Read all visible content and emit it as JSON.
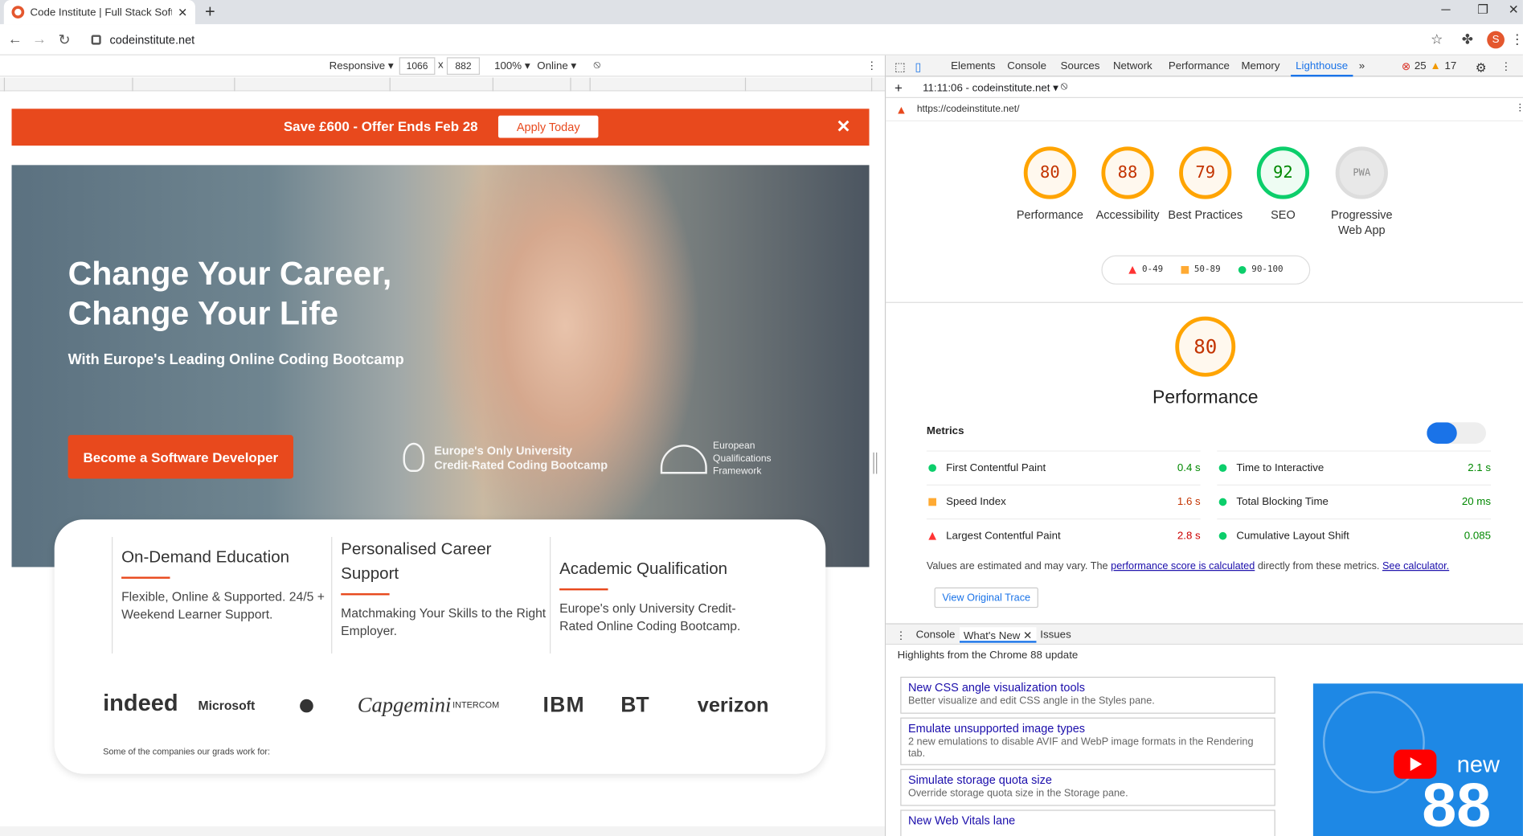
{
  "browser": {
    "tab_title": "Code Institute | Full Stack Softwa",
    "url": "codeinstitute.net",
    "avatar_letter": "S"
  },
  "device_toolbar": {
    "mode": "Responsive",
    "width": "1066",
    "height": "882",
    "zoom": "100%",
    "network": "Online"
  },
  "page": {
    "banner_text": "Save £600 - Offer Ends Feb 28",
    "banner_button": "Apply Today",
    "hero_title_1": "Change Your Career,",
    "hero_title_2": "Change Your Life",
    "hero_subtitle": "With Europe's Leading Online Coding Bootcamp",
    "hero_cta": "Become a Software Developer",
    "badge1_line1": "Europe's Only University",
    "badge1_line2": "Credit-Rated Coding Bootcamp",
    "badge2_line1": "European",
    "badge2_line2": "Qualifications",
    "badge2_line3": "Framework",
    "columns": [
      {
        "title": "On-Demand Education",
        "text": "Flexible, Online & Supported. 24/5 + Weekend Learner Support."
      },
      {
        "title": "Personalised Career Support",
        "text": "Matchmaking Your Skills to the Right Employer."
      },
      {
        "title": "Academic Qualification",
        "text": "Europe's only University Credit-Rated Online Coding Bootcamp."
      }
    ],
    "logos": [
      "indeed",
      "Microsoft",
      "Capgemini",
      "INTERCOM",
      "IBM",
      "BT",
      "verizon"
    ],
    "logos_caption": "Some of the companies our grads work for:"
  },
  "devtools": {
    "tabs": [
      "Elements",
      "Console",
      "Sources",
      "Network",
      "Performance",
      "Memory",
      "Lighthouse"
    ],
    "active_tab": "Lighthouse",
    "errors": "25",
    "warnings": "17",
    "report_time": "11:11:06 - codeinstitute.net",
    "report_url": "https://codeinstitute.net/",
    "scores": [
      {
        "value": "80",
        "label": "Performance"
      },
      {
        "value": "88",
        "label": "Accessibility"
      },
      {
        "value": "79",
        "label": "Best Practices"
      },
      {
        "value": "92",
        "label": "SEO"
      },
      {
        "value": "PWA",
        "label": "Progressive Web App"
      }
    ],
    "legend": [
      "0-49",
      "50-89",
      "90-100"
    ],
    "perf_score": "80",
    "perf_title": "Performance",
    "metrics_title": "Metrics",
    "metrics": [
      {
        "name": "First Contentful Paint",
        "value": "0.4 s",
        "status": "good"
      },
      {
        "name": "Time to Interactive",
        "value": "2.1 s",
        "status": "good"
      },
      {
        "name": "Speed Index",
        "value": "1.6 s",
        "status": "average"
      },
      {
        "name": "Total Blocking Time",
        "value": "20 ms",
        "status": "good"
      },
      {
        "name": "Largest Contentful Paint",
        "value": "2.8 s",
        "status": "fail"
      },
      {
        "name": "Cumulative Layout Shift",
        "value": "0.085",
        "status": "good"
      }
    ],
    "note_pre": "Values are estimated and may vary. The ",
    "note_link1": "performance score is calculated",
    "note_mid": " directly from these metrics. ",
    "note_link2": "See calculator.",
    "trace_button": "View Original Trace",
    "drawer_tabs": [
      "Console",
      "What's New",
      "Issues"
    ],
    "highlights": "Highlights from the Chrome 88 update",
    "whats_new": [
      {
        "title": "New CSS angle visualization tools",
        "desc": "Better visualize and edit CSS angle in the Styles pane."
      },
      {
        "title": "Emulate unsupported image types",
        "desc": "2 new emulations to disable AVIF and WebP image formats in the Rendering tab."
      },
      {
        "title": "Simulate storage quota size",
        "desc": "Override storage quota size in the Storage pane."
      },
      {
        "title": "New Web Vitals lane",
        "desc": ""
      }
    ],
    "promo_new": "new",
    "promo_version": "88"
  },
  "colors": {
    "brand": "#e8491d",
    "good": "#0cce6b",
    "average": "#ffa400",
    "fail": "#ff3333"
  }
}
